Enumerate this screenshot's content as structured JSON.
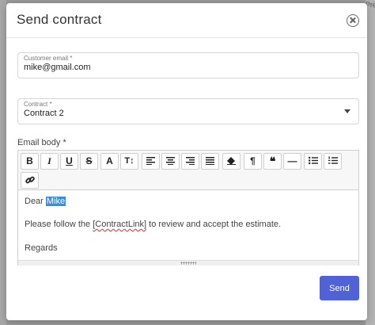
{
  "backdrop": {
    "peek_text": "Pre"
  },
  "modal": {
    "title": "Send contract",
    "close_icon": "close-circle-icon"
  },
  "customer_email": {
    "label": "Customer email *",
    "value": "mike@gmail.com"
  },
  "contract": {
    "label": "Contract *",
    "selected": "Contract 2"
  },
  "email_body": {
    "label": "Email body *",
    "toolbar": [
      {
        "name": "bold-icon",
        "glyph": "B"
      },
      {
        "name": "italic-icon",
        "glyph": "I"
      },
      {
        "name": "underline-icon",
        "glyph": "U"
      },
      {
        "name": "strikethrough-icon",
        "glyph": "S"
      },
      {
        "name": "font-color-icon",
        "glyph": "A"
      },
      {
        "name": "font-size-icon",
        "glyph": "T↕"
      },
      {
        "name": "align-left-icon",
        "glyph": ""
      },
      {
        "name": "align-center-icon",
        "glyph": ""
      },
      {
        "name": "align-right-icon",
        "glyph": ""
      },
      {
        "name": "align-justify-icon",
        "glyph": ""
      },
      {
        "name": "eraser-icon",
        "glyph": ""
      },
      {
        "name": "paragraph-icon",
        "glyph": "¶"
      },
      {
        "name": "quote-icon",
        "glyph": "❝"
      },
      {
        "name": "horizontal-rule-icon",
        "glyph": "—"
      },
      {
        "name": "bullet-list-icon",
        "glyph": ""
      },
      {
        "name": "numbered-list-icon",
        "glyph": ""
      },
      {
        "name": "link-icon",
        "glyph": ""
      }
    ],
    "content": {
      "greeting": "Dear ",
      "name": "Mike",
      "line2_before": "Please follow the ",
      "line2_token": "[ContractLink]",
      "line2_after": " to review and accept the estimate.",
      "closing": "Regards"
    }
  },
  "actions": {
    "send_label": "Send"
  }
}
